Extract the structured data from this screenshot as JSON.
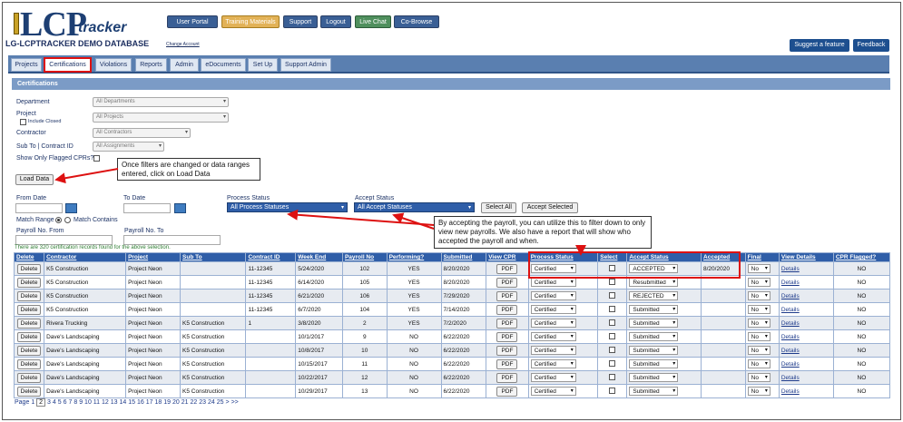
{
  "logo": {
    "big": "LCP",
    "small": "tracker"
  },
  "db_name": "LG-LCPTRACKER DEMO DATABASE",
  "change_account": "Change Account",
  "top_buttons": [
    "User Portal",
    "Training Materials",
    "Support",
    "Logout",
    "Live Chat",
    "Co-Browse"
  ],
  "right_buttons": [
    "Suggest a feature",
    "Feedback"
  ],
  "tabs": [
    "Projects",
    "Certifications",
    "Violations",
    "Reports",
    "Admin",
    "eDocuments",
    "Set Up",
    "Support Admin"
  ],
  "section_title": "Certifications",
  "filters": {
    "department_label": "Department",
    "department_value": "All Departments",
    "project_label": "Project",
    "include_closed": "Include Closed",
    "project_value": "All Projects",
    "contractor_label": "Contractor",
    "contractor_value": "All Contractors",
    "subto_label": "Sub To | Contract ID",
    "subto_value": "All Assignments",
    "flagged_label": "Show Only Flagged CPRs?",
    "load_data": "Load Data",
    "from_date": "From Date",
    "to_date": "To Date",
    "process_status_label": "Process Status",
    "process_status_value": "All Process Statuses",
    "accept_status_label": "Accept Status",
    "accept_status_value": "All Accept Statuses",
    "select_all": "Select All",
    "accept_selected": "Accept Selected",
    "match_range": "Match Range",
    "match_contains": "Match Contains",
    "payroll_from": "Payroll No. From",
    "payroll_to": "Payroll No. To"
  },
  "callouts": {
    "load": "Once filters are changed or data ranges entered, click on Load Data",
    "accept": "By accepting the payroll, you can utilize this to filter down to only view new payrolls.  We also have a report that will show who accepted the payroll and when."
  },
  "found_text": "There are 320 certification records found for the above selection.",
  "table": {
    "headers": [
      "Delete",
      "Contractor",
      "Project",
      "Sub To",
      "Contract ID",
      "Week End",
      "Payroll No",
      "Performing?",
      "Submitted",
      "View CPR",
      "Process Status",
      "Select",
      "Accept Status",
      "Accepted",
      "Final",
      "View Details",
      "CPR Flagged?"
    ],
    "delete_label": "Delete",
    "pdf_label": "PDF",
    "details_label": "Details",
    "rows": [
      {
        "contractor": "K5 Construction",
        "project": "Project Neon",
        "subto": "",
        "contract": "11-12345",
        "week": "5/24/2020",
        "payroll": "102",
        "performing": "YES",
        "submitted": "8/20/2020",
        "process": "Certified",
        "accept": "ACCEPTED",
        "accepted": "8/20/2020",
        "final": "No",
        "flagged": "NO"
      },
      {
        "contractor": "K5 Construction",
        "project": "Project Neon",
        "subto": "",
        "contract": "11-12345",
        "week": "6/14/2020",
        "payroll": "105",
        "performing": "YES",
        "submitted": "8/20/2020",
        "process": "Certified",
        "accept": "Resubmitted",
        "accepted": "",
        "final": "No",
        "flagged": "NO"
      },
      {
        "contractor": "K5 Construction",
        "project": "Project Neon",
        "subto": "",
        "contract": "11-12345",
        "week": "6/21/2020",
        "payroll": "106",
        "performing": "YES",
        "submitted": "7/29/2020",
        "process": "Certified",
        "accept": "REJECTED",
        "accepted": "",
        "final": "No",
        "flagged": "NO"
      },
      {
        "contractor": "K5 Construction",
        "project": "Project Neon",
        "subto": "",
        "contract": "11-12345",
        "week": "6/7/2020",
        "payroll": "104",
        "performing": "YES",
        "submitted": "7/14/2020",
        "process": "Certified",
        "accept": "Submitted",
        "accepted": "",
        "final": "No",
        "flagged": "NO"
      },
      {
        "contractor": "Rivera Trucking",
        "project": "Project Neon",
        "subto": "K5 Construction",
        "contract": "1",
        "week": "3/8/2020",
        "payroll": "2",
        "performing": "YES",
        "submitted": "7/2/2020",
        "process": "Certified",
        "accept": "Submitted",
        "accepted": "",
        "final": "No",
        "flagged": "NO"
      },
      {
        "contractor": "Dave's Landscaping",
        "project": "Project Neon",
        "subto": "K5 Construction",
        "contract": "",
        "week": "10/1/2017",
        "payroll": "9",
        "performing": "NO",
        "submitted": "6/22/2020",
        "process": "Certified",
        "accept": "Submitted",
        "accepted": "",
        "final": "No",
        "flagged": "NO"
      },
      {
        "contractor": "Dave's Landscaping",
        "project": "Project Neon",
        "subto": "K5 Construction",
        "contract": "",
        "week": "10/8/2017",
        "payroll": "10",
        "performing": "NO",
        "submitted": "6/22/2020",
        "process": "Certified",
        "accept": "Submitted",
        "accepted": "",
        "final": "No",
        "flagged": "NO"
      },
      {
        "contractor": "Dave's Landscaping",
        "project": "Project Neon",
        "subto": "K5 Construction",
        "contract": "",
        "week": "10/15/2017",
        "payroll": "11",
        "performing": "NO",
        "submitted": "6/22/2020",
        "process": "Certified",
        "accept": "Submitted",
        "accepted": "",
        "final": "No",
        "flagged": "NO"
      },
      {
        "contractor": "Dave's Landscaping",
        "project": "Project Neon",
        "subto": "K5 Construction",
        "contract": "",
        "week": "10/22/2017",
        "payroll": "12",
        "performing": "NO",
        "submitted": "6/22/2020",
        "process": "Certified",
        "accept": "Submitted",
        "accepted": "",
        "final": "No",
        "flagged": "NO"
      },
      {
        "contractor": "Dave's Landscaping",
        "project": "Project Neon",
        "subto": "K5 Construction",
        "contract": "",
        "week": "10/29/2017",
        "payroll": "13",
        "performing": "NO",
        "submitted": "6/22/2020",
        "process": "Certified",
        "accept": "Submitted",
        "accepted": "",
        "final": "No",
        "flagged": "NO"
      }
    ]
  },
  "pager": {
    "label": "Page",
    "current": "2",
    "pages": [
      "1",
      "3",
      "4",
      "5",
      "6",
      "7",
      "8",
      "9",
      "10",
      "11",
      "12",
      "13",
      "14",
      "15",
      "16",
      "17",
      "18",
      "19",
      "20",
      "21",
      "22",
      "23",
      "24",
      "25"
    ],
    "next": ">",
    "last": ">>"
  },
  "colors": {
    "nav_blue": "#5a7fb0",
    "header_blue": "#2f5ea8",
    "highlight_red": "#dd1111",
    "orange": "#e2b257",
    "green": "#4f8f5d"
  }
}
